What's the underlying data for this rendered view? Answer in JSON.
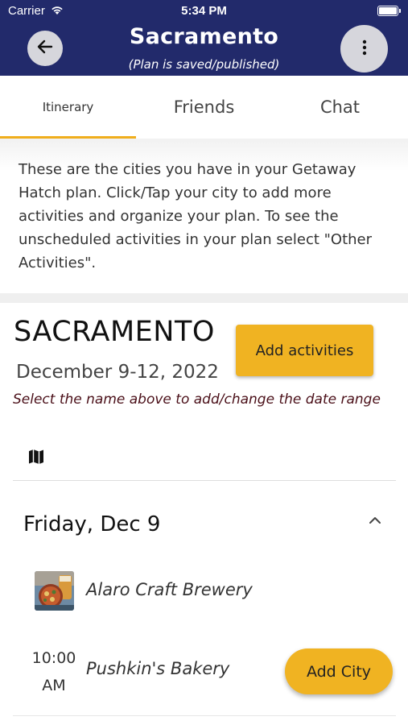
{
  "status_bar": {
    "carrier": "Carrier",
    "time": "5:34 PM"
  },
  "header": {
    "title": "Sacramento",
    "subtitle": "(Plan is saved/published)"
  },
  "tabs": [
    {
      "label": "Itinerary",
      "active": true
    },
    {
      "label": "Friends",
      "active": false
    },
    {
      "label": "Chat",
      "active": false
    }
  ],
  "intro_text": "These are the cities you have in your Getaway Hatch plan. Click/Tap your city to add more activities and organize your plan. To see the unscheduled activities in your plan select \"Other Activities\".",
  "city": {
    "name": "SACRAMENTO",
    "dates": "December 9-12, 2022",
    "add_activities_label": "Add activities",
    "date_hint": "Select the name above to add/change the date range"
  },
  "day": {
    "title": "Friday, Dec 9",
    "activities": [
      {
        "name": "Alaro Craft Brewery",
        "time": "",
        "thumbnail": "food-photo"
      },
      {
        "name": "Pushkin's Bakery",
        "time": "10:00 AM"
      }
    ]
  },
  "fab": {
    "label": "Add City"
  },
  "colors": {
    "header_bg": "#222a6b",
    "accent": "#f0b322",
    "hint_text": "#4a0f18"
  },
  "icons": [
    "wifi-icon",
    "battery-icon",
    "back-arrow-icon",
    "more-vertical-icon",
    "map-icon",
    "chevron-up-icon"
  ]
}
